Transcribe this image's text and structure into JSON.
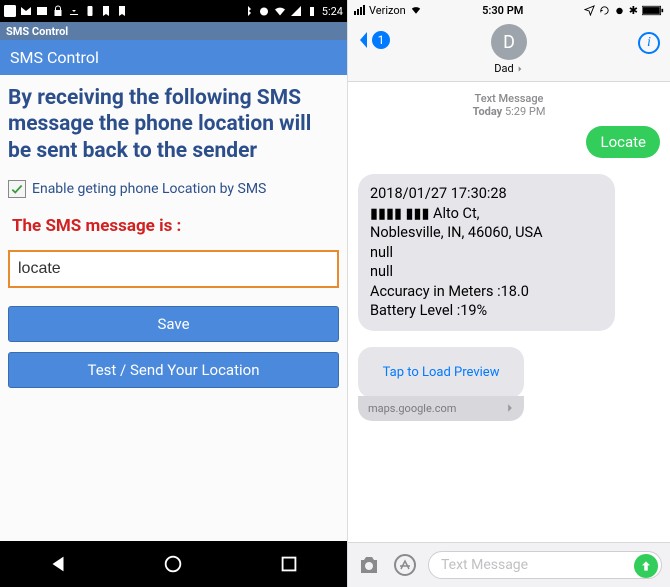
{
  "android": {
    "status": {
      "time": "5:24"
    },
    "app_bar": "SMS Control",
    "title": "SMS Control",
    "headline": "By receiving the following SMS message the phone location will be sent back to the sender",
    "checkbox_label": "Enable geting phone Location by SMS",
    "checkbox_checked": true,
    "red_label": "The SMS message is :",
    "input_value": "locate",
    "save_button": "Save",
    "test_button": "Test / Send Your Location"
  },
  "ios": {
    "status": {
      "carrier": "Verizon",
      "time": "5:30 PM"
    },
    "back_badge": "1",
    "contact_initial": "D",
    "contact_name": "Dad",
    "meta_type": "Text Message",
    "meta_time_prefix": "Today",
    "meta_time": "5:29 PM",
    "outgoing": "Locate",
    "incoming": "2018/01/27 17:30:28\n▮▮▮▮ ▮▮▮ Alto Ct,\nNoblesville, IN, 46060, USA\nnull\nnull\nAccuracy in Meters :18.0\nBattery Level :19%",
    "preview_label": "Tap to Load Preview",
    "preview_domain": "maps.google.com",
    "input_placeholder": "Text Message"
  }
}
